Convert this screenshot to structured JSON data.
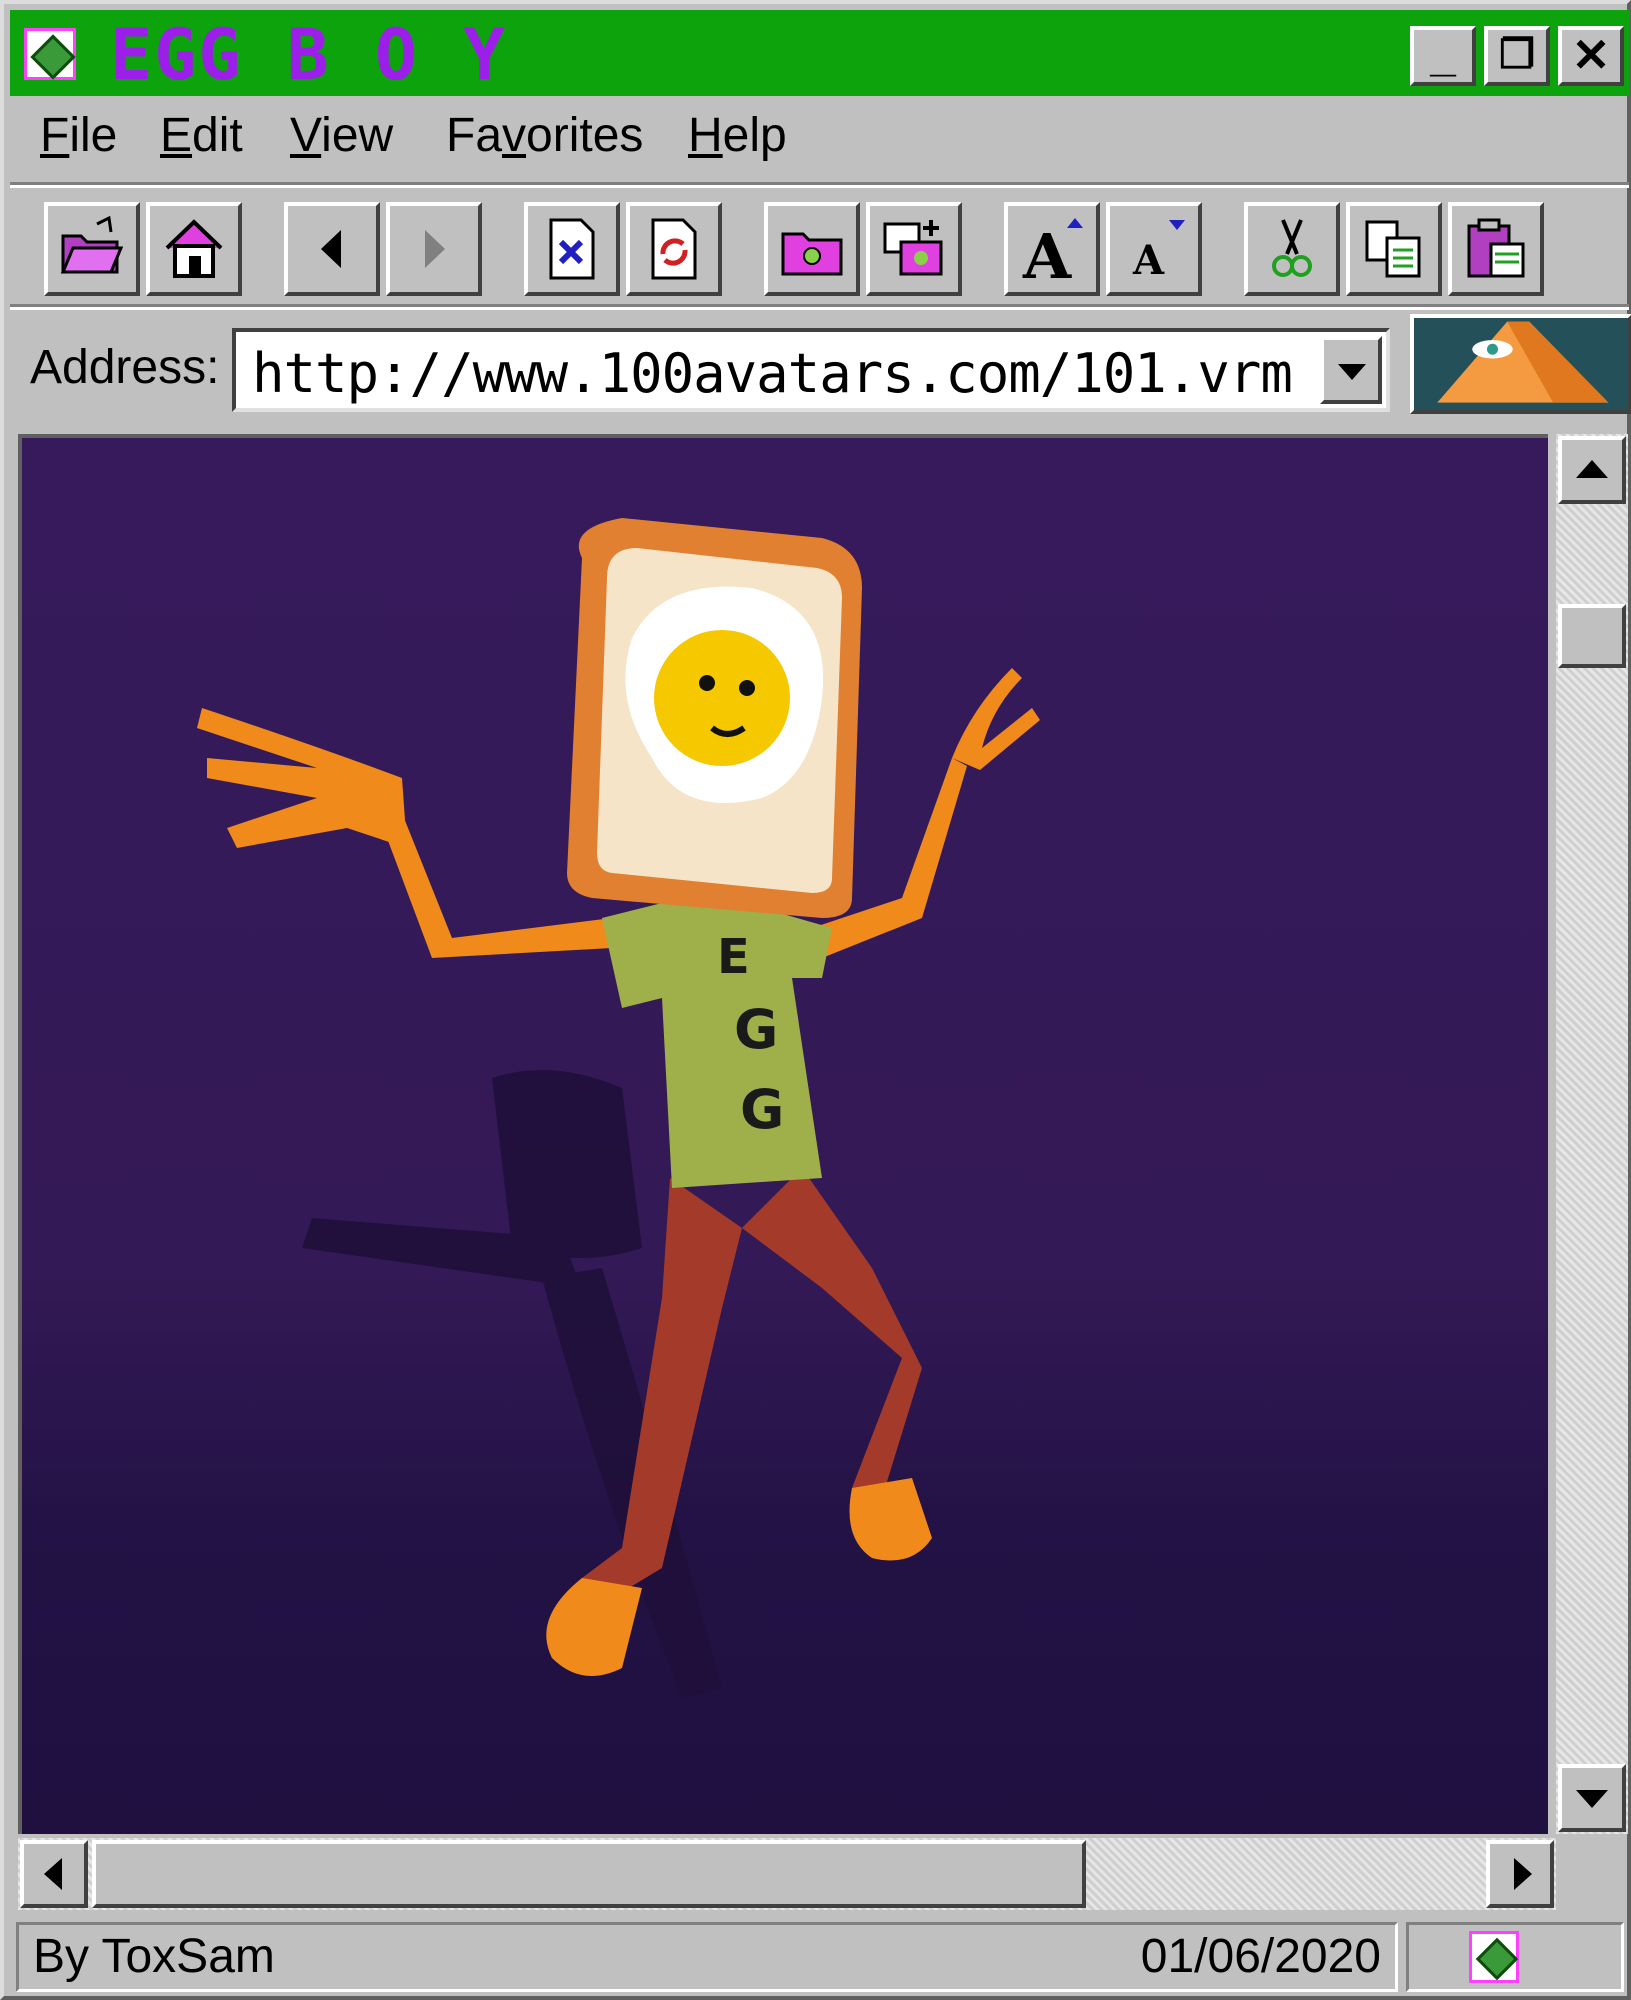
{
  "window": {
    "title": "EGG B O Y",
    "title_color": "#9b1fe8",
    "titlebar_color": "#0ca30c",
    "controls": {
      "minimize": "_",
      "restore": "❐",
      "close": "✕"
    }
  },
  "menu": [
    {
      "key": "F",
      "rest": "ile"
    },
    {
      "key": "E",
      "rest": "dit"
    },
    {
      "key": "V",
      "rest": "iew"
    },
    {
      "pre": "Fa",
      "key": "v",
      "rest": "orites"
    },
    {
      "key": "H",
      "rest": "elp"
    }
  ],
  "toolbar": {
    "icons": [
      "open-folder-icon",
      "home-icon",
      "back-arrow-icon",
      "forward-arrow-icon",
      "stop-page-icon",
      "refresh-page-icon",
      "favorites-folder-icon",
      "new-window-icon",
      "font-larger-icon",
      "font-smaller-icon",
      "cut-icon",
      "copy-icon",
      "paste-icon"
    ],
    "font_larger_glyph": "A",
    "font_smaller_glyph": "A"
  },
  "address": {
    "label": "Address:",
    "value": "http://www.100avatars.com/101.vrm"
  },
  "viewport": {
    "bg_color": "#361a5c",
    "shirt_text": [
      "E",
      "G",
      "G"
    ],
    "shirt_color": "#9fb04a",
    "pants_color": "#a33a2a",
    "skin_color": "#f08a1a"
  },
  "status": {
    "author": "By ToxSam",
    "date": "01/06/2020"
  }
}
